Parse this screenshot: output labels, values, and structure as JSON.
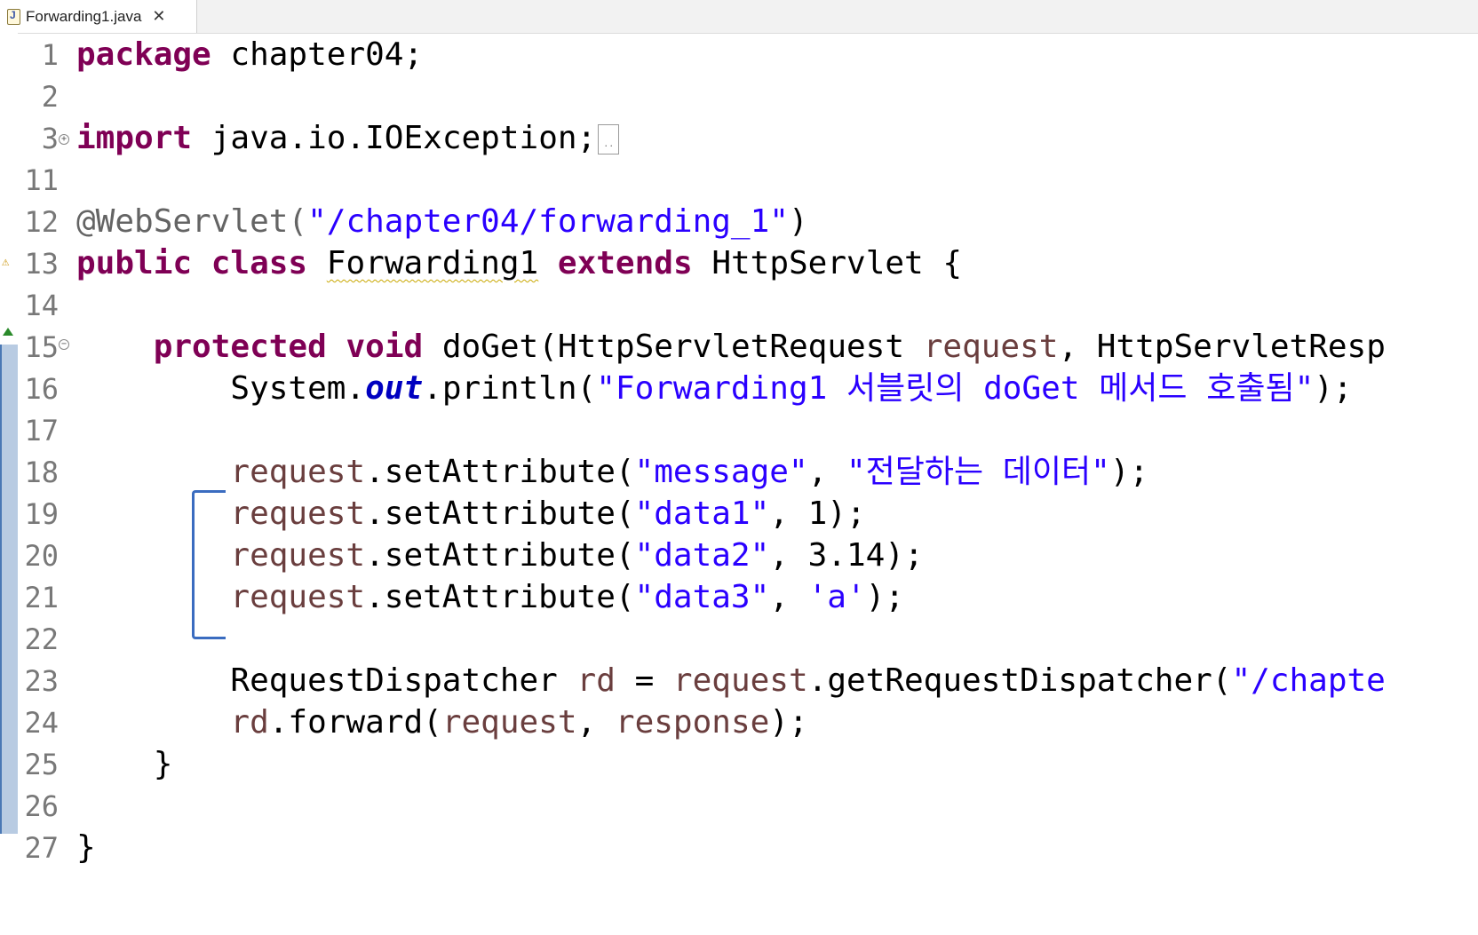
{
  "tab": {
    "label": "Forwarding1.java",
    "icon": "java-file-icon",
    "close": "✕"
  },
  "colors": {
    "keyword": "#7f0055",
    "string": "#2a00ff",
    "variable": "#6a3e3e",
    "annotation": "#646464",
    "field": "#0000c0",
    "line_number": "#787878",
    "bracket": "#3a6cc0"
  },
  "lines": [
    {
      "num": "1",
      "code": "package chapter04;"
    },
    {
      "num": "2",
      "code": ""
    },
    {
      "num": "3",
      "code": "import java.io.IOException;"
    },
    {
      "num": "11",
      "code": ""
    },
    {
      "num": "12",
      "code": "@WebServlet(\"/chapter04/forwarding_1\")"
    },
    {
      "num": "13",
      "code": "public class Forwarding1 extends HttpServlet {"
    },
    {
      "num": "14",
      "code": ""
    },
    {
      "num": "15",
      "code": "    protected void doGet(HttpServletRequest request, HttpServletResp"
    },
    {
      "num": "16",
      "code": "        System.out.println(\"Forwarding1 서블릿의 doGet 메서드 호출됨\");"
    },
    {
      "num": "17",
      "code": ""
    },
    {
      "num": "18",
      "code": "        request.setAttribute(\"message\", \"전달하는 데이터\");"
    },
    {
      "num": "19",
      "code": "        request.setAttribute(\"data1\", 1);"
    },
    {
      "num": "20",
      "code": "        request.setAttribute(\"data2\", 3.14);"
    },
    {
      "num": "21",
      "code": "        request.setAttribute(\"data3\", 'a');"
    },
    {
      "num": "22",
      "code": ""
    },
    {
      "num": "23",
      "code": "        RequestDispatcher rd = request.getRequestDispatcher(\"/chapte"
    },
    {
      "num": "24",
      "code": "        rd.forward(request, response);"
    },
    {
      "num": "25",
      "code": "    }"
    },
    {
      "num": "26",
      "code": ""
    },
    {
      "num": "27",
      "code": "}"
    }
  ],
  "tokens": {
    "l1": [
      "package",
      "chapter04;"
    ],
    "l3": [
      "import",
      "java.io.IOException;"
    ],
    "l12": [
      "@WebServlet(",
      "\"/chapter04/forwarding_1\"",
      ")"
    ],
    "l13": [
      "public",
      "class",
      "Forwarding1",
      "extends",
      "HttpServlet {"
    ],
    "l15": [
      "protected",
      "void",
      "doGet(HttpServletRequest ",
      "request",
      ", HttpServletResp"
    ],
    "l16": [
      "System.",
      "out",
      ".println(",
      "\"Forwarding1 서블릿의 doGet 메서드 호출됨\"",
      ");"
    ],
    "l18": [
      "request",
      ".setAttribute(",
      "\"message\"",
      ", ",
      "\"전달하는 데이터\"",
      ");"
    ],
    "l19": [
      "request",
      ".setAttribute(",
      "\"data1\"",
      ", 1);"
    ],
    "l20": [
      "request",
      ".setAttribute(",
      "\"data2\"",
      ", 3.14);"
    ],
    "l21": [
      "request",
      ".setAttribute(",
      "\"data3\"",
      ", ",
      "'a'",
      ");"
    ],
    "l23": [
      "RequestDispatcher ",
      "rd",
      " = ",
      "request",
      ".getRequestDispatcher(",
      "\"/chapte"
    ],
    "l24": [
      "rd",
      ".forward(",
      "request",
      ", ",
      "response",
      ");"
    ],
    "l25": [
      "}"
    ],
    "l27": [
      "}"
    ]
  }
}
